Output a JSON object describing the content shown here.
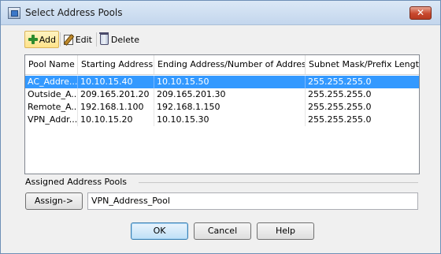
{
  "window": {
    "title": "Select Address Pools",
    "close_label": "✕"
  },
  "toolbar": {
    "add_label": "Add",
    "edit_label": "Edit",
    "delete_label": "Delete"
  },
  "table": {
    "columns": [
      "Pool Name",
      "Starting Address",
      "Ending Address/Number of Addresses",
      "Subnet Mask/Prefix Length"
    ],
    "rows": [
      [
        "AC_Addre...",
        "10.10.15.40",
        "10.10.15.50",
        "255.255.255.0"
      ],
      [
        "Outside_A...",
        "209.165.201.20",
        "209.165.201.30",
        "255.255.255.0"
      ],
      [
        "Remote_A...",
        "192.168.1.100",
        "192.168.1.150",
        "255.255.255.0"
      ],
      [
        "VPN_Addr...",
        "10.10.15.20",
        "10.10.15.30",
        "255.255.255.0"
      ]
    ],
    "selected_row": 0,
    "selection_color": "#3399ff"
  },
  "assigned": {
    "group_label": "Assigned Address Pools",
    "assign_label": "Assign->",
    "value": "VPN_Address_Pool"
  },
  "buttons": {
    "ok": "OK",
    "cancel": "Cancel",
    "help": "Help"
  }
}
